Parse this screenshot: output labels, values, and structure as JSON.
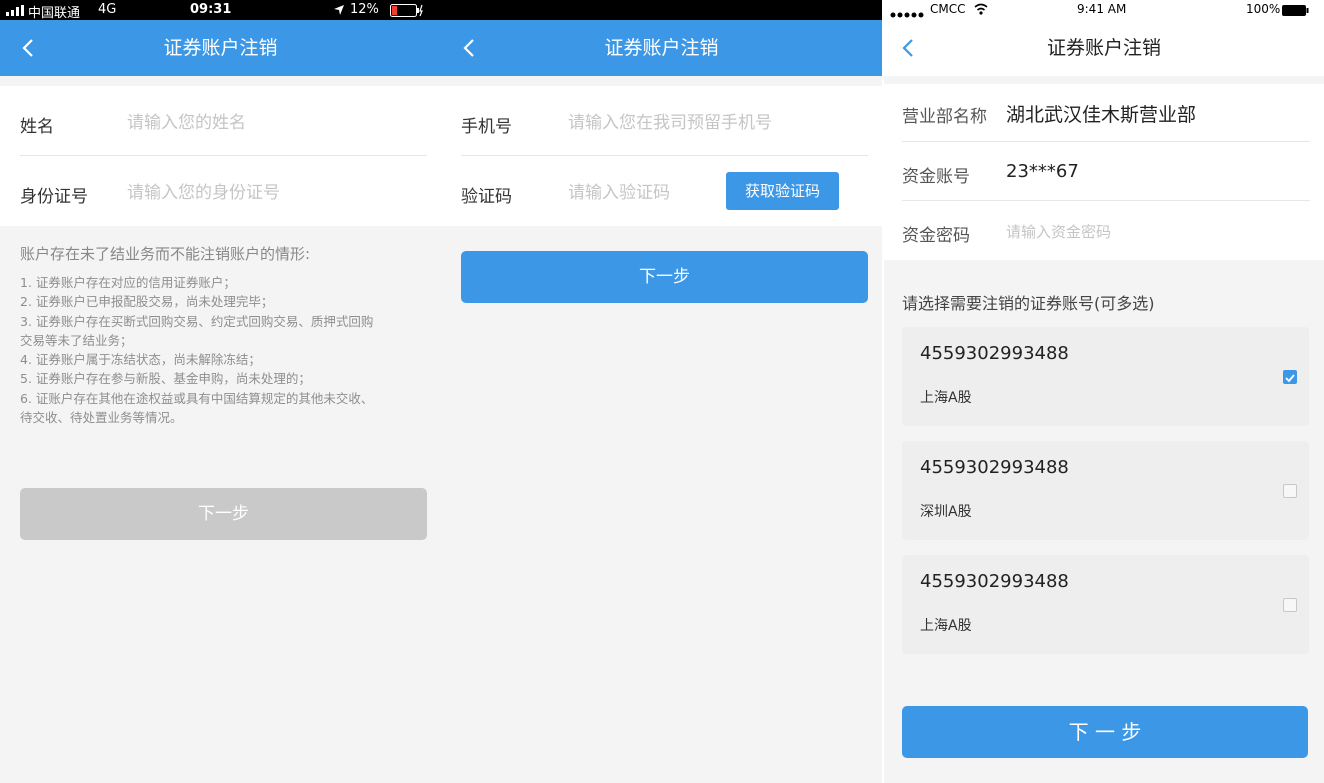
{
  "screen1": {
    "status": {
      "carrier": "中国联通",
      "network": "4G",
      "time": "09:31",
      "battery": "12%"
    },
    "title": "证券账户注销",
    "form": {
      "name_label": "姓名",
      "name_placeholder": "请输入您的姓名",
      "id_label": "身份证号",
      "id_placeholder": "请输入您的身份证号"
    },
    "notice": {
      "heading": "账户存在未了结业务而不能注销账户的情形:",
      "items": [
        "1. 证券账户存在对应的信用证券账户；",
        "2. 证券账户已申报配股交易，尚未处理完毕；",
        "3. 证券账户存在买断式回购交易、约定式回购交易、质押式回购",
        "交易等未了结业务；",
        "4. 证券账户属于冻结状态，尚未解除冻结；",
        "5. 证券账户存在参与新股、基金申购，尚未处理的；",
        "6. 证账户存在其他在途权益或具有中国结算规定的其他未交收、",
        "待交收、待处置业务等情况。"
      ]
    },
    "next_label": "下一步"
  },
  "screen2": {
    "title": "证券账户注销",
    "form": {
      "phone_label": "手机号",
      "phone_placeholder": "请输入您在我司预留手机号",
      "code_label": "验证码",
      "code_placeholder": "请输入验证码",
      "get_code_label": "获取验证码"
    },
    "next_label": "下一步"
  },
  "screen3": {
    "status": {
      "carrier": "CMCC",
      "time": "9:41 AM",
      "battery": "100%"
    },
    "title": "证券账户注销",
    "branch_label": "营业部名称",
    "branch_value": "湖北武汉佳木斯营业部",
    "fund_account_label": "资金账号",
    "fund_account_value": "23***67",
    "fund_password_label": "资金密码",
    "fund_password_placeholder": "请输入资金密码",
    "select_prompt": "请选择需要注销的证券账号(可多选)",
    "accounts": [
      {
        "number": "4559302993488",
        "market": "上海A股",
        "checked": true
      },
      {
        "number": "4559302993488",
        "market": "深圳A股",
        "checked": false
      },
      {
        "number": "4559302993488",
        "market": "上海A股",
        "checked": false
      }
    ],
    "next_label": "下 一 步"
  },
  "colors": {
    "primary": "#3c98e6",
    "disabled": "#c9c9c9",
    "background": "#f4f4f4"
  }
}
